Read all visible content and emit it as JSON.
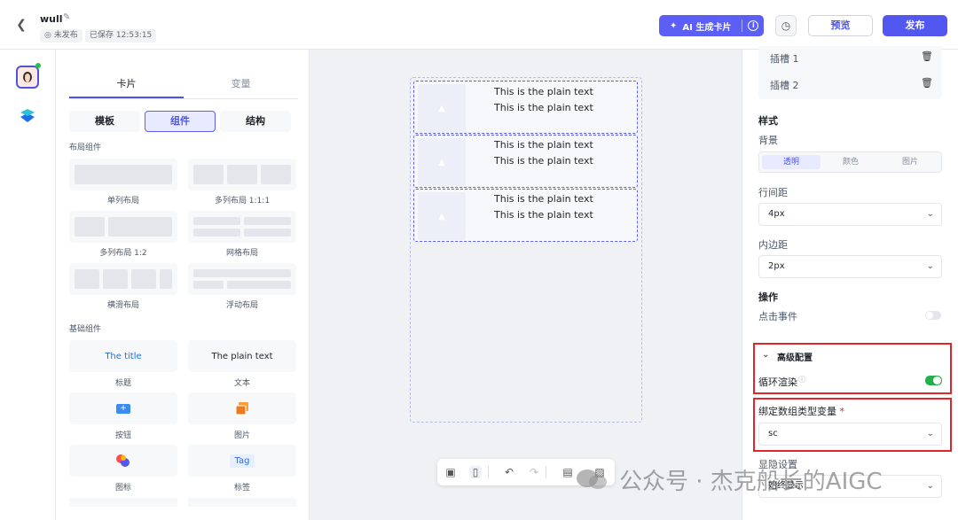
{
  "header": {
    "title": "wull",
    "status": "未发布",
    "saved": "已保存 12:53:15",
    "ai_button": "AI 生成卡片",
    "preview": "预览",
    "publish": "发布"
  },
  "panel": {
    "tabs": [
      "卡片",
      "变量"
    ],
    "segments": [
      "模板",
      "组件",
      "结构"
    ],
    "layout_section": "布局组件",
    "layouts": [
      "单列布局",
      "多列布局 1:1:1",
      "多列布局 1:2",
      "网格布局",
      "横滑布局",
      "浮动布局"
    ],
    "basic_section": "基础组件",
    "basic": [
      {
        "label": "标题",
        "preview": "The title"
      },
      {
        "label": "文本",
        "preview": "The plain text"
      },
      {
        "label": "按钮",
        "preview": ""
      },
      {
        "label": "图片",
        "preview": ""
      },
      {
        "label": "图标",
        "preview": ""
      },
      {
        "label": "标签",
        "preview": "Tag"
      }
    ]
  },
  "canvas": {
    "items": [
      {
        "line1": "This is the plain text",
        "line2": "This is the plain text"
      },
      {
        "line1": "This is the plain text",
        "line2": "This is the plain text"
      },
      {
        "line1": "This is the plain text",
        "line2": "This is the plain text"
      }
    ]
  },
  "props": {
    "slots": [
      "插槽 1",
      "插槽 2"
    ],
    "style_heading": "样式",
    "bg_label": "背景",
    "bg_options": [
      "透明",
      "颜色",
      "图片"
    ],
    "line_gap_label": "行间距",
    "line_gap_value": "4px",
    "padding_label": "内边距",
    "padding_value": "2px",
    "ops_heading": "操作",
    "click_label": "点击事件",
    "adv_heading": "高级配置",
    "loop_label": "循环渲染",
    "bind_label": "绑定数组类型变量",
    "bind_required": "*",
    "bind_value": "sc",
    "visibility_label": "显隐设置",
    "visibility_value": "始终显示"
  },
  "colors": {
    "accent": "#5257f0",
    "toggle_on": "#23b04a",
    "highlight": "#e0262b"
  },
  "watermark": "公众号 · 杰克船长的AIGC"
}
